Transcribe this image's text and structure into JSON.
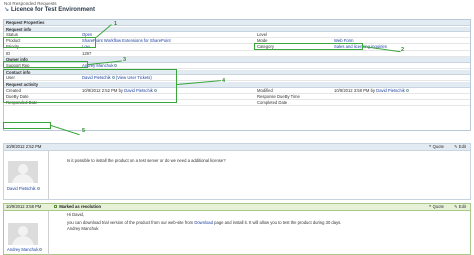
{
  "breadcrumb": "Not Responded Requests",
  "page_title": "Licence for Test Environment",
  "panel": {
    "title": "Request Properties",
    "sections": {
      "request_info": "Request info",
      "owner_info": "Owner info",
      "contact_info": "Contact info",
      "request_activity": "Request activity"
    },
    "labels": {
      "status": "Status",
      "level": "Level",
      "product": "Product",
      "mode": "Mode",
      "priority": "Priority",
      "category": "Category",
      "id": "ID",
      "support_rep": "Support Rep",
      "user": "User",
      "created": "Created",
      "by": "by",
      "modified": "Modified",
      "duedate": "DueBy Date",
      "response_duedate": "Response DueBy Time",
      "responded_date": "Responded Date",
      "completed_date": "Completed Date"
    },
    "values": {
      "status": "Open",
      "product": "SharePoint Workflow Extensions for SharePoint",
      "mode": "Web Form",
      "priority": "Low",
      "category": "Sales and licensing inquiries",
      "id": "1297",
      "support_rep": "Andrey Manchuk",
      "user": "David Pietschik",
      "view_tickets": "(View User Tickets)",
      "created_date": "10/9/2012 2:52 PM",
      "created_by": "David Pietschik",
      "modified_date": "10/9/2012 3:58 PM",
      "modified_by": "David Pietschik"
    }
  },
  "callouts": [
    "1",
    "2",
    "3",
    "4",
    "5"
  ],
  "messages": [
    {
      "date": "10/9/2012 2:52 PM",
      "text": "Is it possible to install the product on a test server or do we need a additional license?",
      "author": "David Pietschik",
      "quote": "Quote",
      "edit": "Edit"
    },
    {
      "date": "10/9/2012 3:58 PM",
      "resolution": "Marked as resolution",
      "greeting": "Hi David,",
      "text_before": "you can download trial version of the product from our web-site from ",
      "link": "Download",
      "text_after": " page and install it. It will allow you to test the product during 30 days.",
      "signature": "Andrey Manchuk",
      "author": "Andrey Manchuk",
      "quote": "Quote",
      "edit": "Edit"
    }
  ]
}
